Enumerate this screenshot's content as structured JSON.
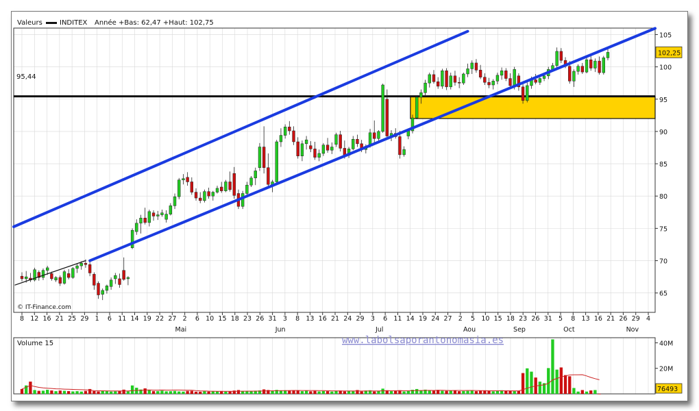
{
  "header": {
    "label_valeurs": "Valeurs",
    "ticker": "INDITEX",
    "stats": "Année +Bas: 62,47 +Haut: 102,75"
  },
  "resistance_label": "95,44",
  "last_price_label": "102,25",
  "credit": "© IT-Finance.com",
  "watermark": "www.labolsaporantonomasia.es",
  "volume_title": "Volume 15",
  "volume_last_label": "76493",
  "colors": {
    "up": "#22cc22",
    "down": "#cc1111",
    "channel": "#1a3be0",
    "zone_fill": "#ffd200",
    "volume_ma": "#cc2222",
    "grid": "#d8d8d8"
  },
  "chart_data": [
    {
      "type": "candlestick",
      "title": "INDITEX",
      "y_ticks": [
        65,
        70,
        75,
        80,
        85,
        90,
        95,
        100,
        105
      ],
      "ylim": [
        62,
        106
      ],
      "x_tick_labels": [
        "8",
        "12",
        "16",
        "21",
        "25",
        "29",
        "1",
        "6",
        "11",
        "14",
        "19",
        "22",
        "27",
        "2",
        "6",
        "10",
        "15",
        "18",
        "23",
        "26",
        "31",
        "3",
        "8",
        "13",
        "16",
        "21",
        "24",
        "29",
        "3",
        "6",
        "11",
        "14",
        "19",
        "24",
        "27",
        "2",
        "5",
        "10",
        "15",
        "18",
        "23",
        "26",
        "31",
        "5",
        "8",
        "13",
        "16",
        "21",
        "26",
        "29",
        "4"
      ],
      "month_labels": [
        "Mai",
        "Jun",
        "Jul",
        "Aou",
        "Sep",
        "Oct",
        "Nov"
      ],
      "ohlc": [
        [
          67.6,
          68.2,
          66.8,
          67.2
        ],
        [
          67.2,
          68.4,
          66.6,
          67.5
        ],
        [
          67.3,
          68.1,
          66.7,
          67.0
        ],
        [
          67.0,
          68.9,
          66.8,
          68.6
        ],
        [
          68.2,
          68.5,
          66.9,
          67.4
        ],
        [
          67.4,
          68.8,
          67.0,
          68.5
        ],
        [
          68.5,
          69.2,
          67.8,
          68.9
        ],
        [
          68.0,
          68.3,
          66.9,
          67.2
        ],
        [
          67.0,
          67.6,
          66.7,
          67.4
        ],
        [
          67.4,
          67.7,
          66.1,
          66.5
        ],
        [
          66.5,
          68.6,
          66.3,
          68.3
        ],
        [
          68.0,
          68.7,
          67.1,
          67.4
        ],
        [
          67.4,
          69.0,
          67.2,
          68.8
        ],
        [
          68.8,
          69.6,
          68.1,
          69.2
        ],
        [
          69.2,
          69.9,
          68.6,
          69.6
        ],
        [
          69.6,
          70.2,
          68.9,
          69.4
        ],
        [
          69.4,
          70.1,
          67.6,
          68.1
        ],
        [
          67.9,
          68.2,
          65.5,
          66.2
        ],
        [
          66.5,
          66.8,
          64.1,
          64.7
        ],
        [
          64.8,
          65.7,
          63.9,
          65.4
        ],
        [
          65.4,
          66.3,
          64.9,
          66.1
        ],
        [
          66.0,
          67.4,
          65.5,
          67.0
        ],
        [
          67.2,
          68.1,
          66.4,
          67.7
        ],
        [
          67.2,
          68.0,
          65.8,
          66.3
        ],
        [
          68.5,
          70.5,
          66.9,
          67.1
        ],
        [
          67.2,
          67.6,
          66.2,
          67.4
        ],
        [
          72.0,
          75.0,
          71.8,
          74.7
        ],
        [
          74.5,
          76.4,
          74.0,
          75.8
        ],
        [
          75.8,
          77.1,
          74.2,
          76.6
        ],
        [
          76.6,
          78.2,
          75.6,
          75.9
        ],
        [
          75.9,
          77.9,
          75.3,
          77.6
        ],
        [
          77.4,
          77.8,
          76.2,
          76.9
        ],
        [
          76.9,
          77.7,
          76.3,
          77.1
        ],
        [
          77.1,
          77.9,
          76.8,
          77.4
        ],
        [
          76.4,
          77.8,
          75.9,
          77.2
        ],
        [
          77.2,
          78.9,
          77.0,
          78.5
        ],
        [
          78.5,
          80.4,
          78.0,
          79.9
        ],
        [
          79.9,
          82.8,
          79.5,
          82.5
        ],
        [
          82.5,
          83.4,
          81.8,
          82.7
        ],
        [
          82.9,
          83.7,
          81.6,
          82.2
        ],
        [
          82.2,
          82.9,
          80.2,
          80.6
        ],
        [
          80.6,
          81.2,
          79.3,
          79.7
        ],
        [
          79.7,
          80.6,
          78.9,
          79.3
        ],
        [
          79.3,
          81.0,
          79.0,
          80.7
        ],
        [
          80.7,
          81.3,
          79.6,
          80.0
        ],
        [
          80.0,
          80.8,
          79.3,
          80.6
        ],
        [
          80.6,
          81.6,
          80.4,
          81.2
        ],
        [
          81.4,
          82.2,
          80.5,
          80.8
        ],
        [
          80.8,
          82.5,
          80.6,
          82.2
        ],
        [
          82.2,
          83.8,
          80.7,
          81.0
        ],
        [
          83.5,
          84.5,
          79.6,
          80.1
        ],
        [
          80.4,
          81.0,
          78.0,
          78.4
        ],
        [
          78.4,
          80.8,
          78.0,
          80.4
        ],
        [
          80.4,
          82.2,
          80.0,
          81.7
        ],
        [
          81.7,
          83.1,
          81.4,
          82.8
        ],
        [
          82.8,
          84.4,
          81.7,
          83.9
        ],
        [
          84.4,
          88.2,
          83.9,
          87.6
        ],
        [
          87.6,
          90.8,
          83.5,
          84.4
        ],
        [
          84.4,
          86.6,
          81.3,
          81.8
        ],
        [
          81.8,
          82.5,
          80.6,
          82.2
        ],
        [
          82.2,
          88.7,
          81.9,
          88.4
        ],
        [
          88.4,
          90.5,
          87.6,
          89.4
        ],
        [
          89.4,
          91.1,
          88.9,
          90.7
        ],
        [
          90.7,
          91.6,
          89.5,
          90.1
        ],
        [
          90.1,
          90.8,
          87.9,
          88.4
        ],
        [
          88.4,
          89.1,
          85.8,
          86.2
        ],
        [
          86.2,
          88.6,
          85.4,
          88.1
        ],
        [
          88.1,
          89.3,
          87.2,
          88.7
        ],
        [
          87.8,
          88.5,
          86.8,
          87.3
        ],
        [
          87.3,
          88.4,
          85.6,
          86.0
        ],
        [
          86.0,
          87.2,
          85.4,
          86.6
        ],
        [
          86.6,
          88.2,
          86.2,
          87.9
        ],
        [
          87.9,
          89.0,
          86.7,
          87.1
        ],
        [
          87.1,
          88.3,
          86.5,
          87.6
        ],
        [
          88.0,
          89.8,
          87.6,
          89.5
        ],
        [
          89.5,
          90.1,
          86.9,
          87.4
        ],
        [
          87.4,
          88.6,
          85.8,
          86.3
        ],
        [
          86.3,
          87.6,
          85.9,
          87.3
        ],
        [
          87.3,
          89.3,
          87.1,
          88.8
        ],
        [
          88.8,
          89.5,
          87.6,
          88.1
        ],
        [
          88.1,
          88.7,
          86.8,
          87.2
        ],
        [
          87.2,
          88.0,
          86.6,
          87.7
        ],
        [
          87.9,
          90.4,
          87.5,
          89.8
        ],
        [
          89.8,
          91.7,
          88.3,
          88.9
        ],
        [
          88.9,
          90.2,
          88.6,
          90.0
        ],
        [
          90.0,
          97.4,
          89.8,
          97.2
        ],
        [
          95.0,
          96.5,
          88.8,
          89.3
        ],
        [
          89.3,
          90.2,
          88.5,
          89.7
        ],
        [
          89.7,
          90.5,
          88.9,
          89.2
        ],
        [
          89.2,
          90.1,
          85.8,
          86.4
        ],
        [
          86.4,
          87.7,
          86.1,
          87.2
        ],
        [
          89.3,
          90.4,
          88.8,
          90.1
        ],
        [
          90.1,
          92.6,
          89.7,
          92.1
        ],
        [
          92.1,
          95.5,
          91.9,
          95.3
        ],
        [
          95.3,
          96.5,
          94.3,
          96.0
        ],
        [
          96.0,
          98.0,
          95.6,
          97.5
        ],
        [
          97.5,
          99.1,
          96.8,
          98.8
        ],
        [
          98.8,
          99.5,
          97.4,
          97.7
        ],
        [
          97.7,
          98.4,
          96.6,
          97.0
        ],
        [
          97.0,
          99.7,
          96.6,
          99.4
        ],
        [
          99.4,
          99.8,
          96.4,
          96.9
        ],
        [
          96.9,
          99.1,
          96.5,
          98.6
        ],
        [
          98.6,
          99.4,
          97.1,
          97.6
        ],
        [
          97.6,
          98.4,
          96.7,
          97.5
        ],
        [
          97.5,
          99.1,
          97.2,
          98.9
        ],
        [
          98.9,
          100.5,
          98.4,
          99.7
        ],
        [
          99.7,
          101.0,
          98.9,
          100.6
        ],
        [
          100.6,
          101.2,
          99.1,
          99.5
        ],
        [
          99.5,
          100.3,
          98.1,
          98.4
        ],
        [
          98.4,
          99.0,
          97.2,
          97.6
        ],
        [
          97.6,
          98.3,
          96.7,
          97.2
        ],
        [
          97.2,
          98.1,
          96.5,
          97.8
        ],
        [
          97.8,
          99.1,
          97.3,
          98.7
        ],
        [
          98.7,
          99.9,
          98.0,
          99.4
        ],
        [
          99.4,
          99.8,
          97.8,
          98.2
        ],
        [
          98.2,
          99.0,
          96.6,
          97.1
        ],
        [
          97.1,
          100.0,
          96.5,
          99.6
        ],
        [
          98.6,
          99.0,
          96.3,
          96.9
        ],
        [
          96.9,
          97.4,
          94.3,
          94.8
        ],
        [
          94.8,
          97.6,
          94.5,
          97.1
        ],
        [
          97.1,
          98.5,
          96.6,
          98.0
        ],
        [
          98.0,
          98.9,
          97.3,
          97.6
        ],
        [
          97.6,
          98.4,
          97.2,
          98.2
        ],
        [
          98.2,
          99.0,
          97.8,
          98.6
        ],
        [
          98.6,
          100.0,
          98.1,
          99.6
        ],
        [
          99.6,
          100.6,
          99.3,
          100.2
        ],
        [
          100.2,
          103.0,
          99.7,
          102.4
        ],
        [
          102.4,
          102.9,
          100.6,
          101.0
        ],
        [
          101.0,
          101.5,
          99.8,
          100.1
        ],
        [
          100.1,
          100.9,
          97.4,
          97.8
        ],
        [
          97.8,
          99.6,
          96.9,
          99.3
        ],
        [
          99.3,
          100.4,
          98.8,
          100.1
        ],
        [
          100.1,
          100.6,
          98.9,
          99.2
        ],
        [
          99.2,
          101.5,
          99.0,
          101.1
        ],
        [
          101.1,
          101.7,
          99.4,
          99.8
        ],
        [
          99.8,
          101.3,
          99.2,
          100.9
        ],
        [
          100.9,
          101.6,
          98.8,
          99.1
        ],
        [
          99.1,
          101.7,
          98.8,
          101.4
        ],
        [
          101.4,
          102.75,
          101.0,
          102.25
        ]
      ],
      "annotations": [
        {
          "type": "hline",
          "y": 95.44
        },
        {
          "type": "zone",
          "y_low": 92.0,
          "y_high": 95.4,
          "from_index": 92
        },
        {
          "type": "trendline",
          "points": [
            [
              0,
              75.8
            ],
            [
              105,
              105.5
            ]
          ]
        },
        {
          "type": "trendline",
          "points": [
            [
              16,
              70.0
            ],
            [
              133,
              101.6
            ]
          ]
        },
        {
          "type": "trendline",
          "points": [
            [
              0,
              66.6
            ],
            [
              15,
              70.0
            ]
          ]
        }
      ]
    },
    {
      "type": "bar",
      "title": "Volume 15",
      "y_ticks": [
        "20M",
        "40M"
      ],
      "ylim": [
        0,
        44000000
      ],
      "volumes": [
        3800000,
        6600000,
        9600000,
        3000000,
        2400000,
        2500000,
        3200000,
        2700000,
        2100000,
        2600000,
        2400000,
        2200000,
        1900000,
        2100000,
        1800000,
        2300000,
        3800000,
        2200000,
        1900000,
        2400000,
        2100000,
        1800000,
        2000000,
        2200000,
        3300000,
        2000000,
        6600000,
        4800000,
        3400000,
        4300000,
        3000000,
        2200000,
        2200000,
        2500000,
        2000000,
        2100000,
        2300000,
        1900000,
        1800000,
        2300000,
        2400000,
        1700000,
        1700000,
        2100000,
        1800000,
        2100000,
        1900000,
        2200000,
        1800000,
        2000000,
        2600000,
        3000000,
        2300000,
        2200000,
        2100000,
        2500000,
        2700000,
        3500000,
        3000000,
        2500000,
        3100000,
        2600000,
        2800000,
        2400000,
        2800000,
        2700000,
        2100000,
        2400000,
        2000000,
        2300000,
        1900000,
        2200000,
        2100000,
        1800000,
        2300000,
        2600000,
        2000000,
        2400000,
        2100000,
        3000000,
        1900000,
        2600000,
        2800000,
        1900000,
        2300000,
        4100000,
        2800000,
        2100000,
        2300000,
        2800000,
        1900000,
        2200000,
        3200000,
        3800000,
        2800000,
        3300000,
        2600000,
        2400000,
        3100000,
        2400000,
        2300000,
        2600000,
        2700000,
        2100000,
        2200000,
        2300000,
        2700000,
        2100000,
        2400000,
        2500000,
        2300000,
        2000000,
        2600000,
        2800000,
        2300000,
        2500000,
        2100000,
        2300000,
        16300000,
        20000000,
        17400000,
        12800000,
        9600000,
        8400000,
        20200000,
        42700000,
        19000000,
        20700000,
        14700000,
        13800000,
        4600000,
        1800000,
        3000000,
        1800000,
        2700000,
        3000000,
        76493
      ]
    }
  ]
}
